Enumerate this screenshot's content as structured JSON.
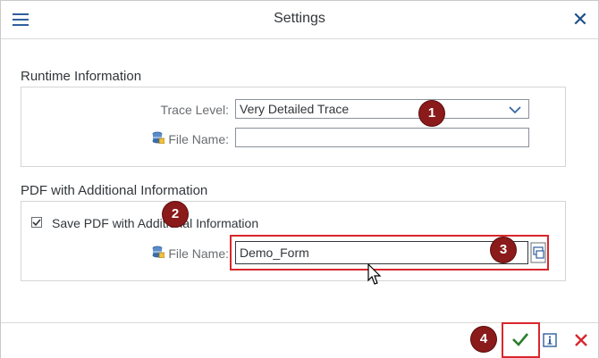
{
  "dialog": {
    "title": "Settings"
  },
  "runtime": {
    "section_title": "Runtime Information",
    "trace_level_label": "Trace Level:",
    "trace_level_value": "Very Detailed Trace",
    "file_name_label": "File Name:",
    "file_name_value": ""
  },
  "pdf": {
    "section_title": "PDF with Additional Information",
    "save_checkbox_label": "Save PDF with Additional Information",
    "save_checked": true,
    "file_name_label": "File Name:",
    "file_name_value": "Demo_Form"
  },
  "annotations": {
    "step1": "1",
    "step2": "2",
    "step3": "3",
    "step4": "4"
  },
  "colors": {
    "accent": "#2f5f9e",
    "confirm": "#2b7d2b",
    "cancel": "#d9262c",
    "badge": "#8b1a1a"
  }
}
